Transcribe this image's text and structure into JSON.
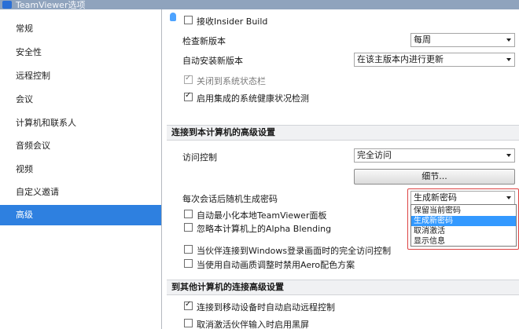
{
  "window": {
    "title": "TeamViewer选项"
  },
  "sidebar": {
    "items": [
      {
        "label": "常规"
      },
      {
        "label": "安全性"
      },
      {
        "label": "远程控制"
      },
      {
        "label": "会议"
      },
      {
        "label": "计算机和联系人"
      },
      {
        "label": "音频会议"
      },
      {
        "label": "视频"
      },
      {
        "label": "自定义邀请"
      },
      {
        "label": "高级",
        "active": true
      }
    ]
  },
  "general": {
    "insider_label": "接收Insider Build",
    "check_version_label": "检查新版本",
    "check_version_value": "每周",
    "auto_install_label": "自动安装新版本",
    "auto_install_value": "在该主版本内进行更新",
    "close_tray_label": "关闭到系统状态栏",
    "health_check_label": "启用集成的系统健康状况检测"
  },
  "incoming": {
    "section_title": "连接到本计算机的高级设置",
    "access_label": "访问控制",
    "access_value": "完全访问",
    "details_button": "细节...",
    "random_pw_label": "每次会话后随机生成密码",
    "random_pw_value": "生成新密码",
    "random_pw_options": [
      "保留当前密码",
      "生成新密码",
      "取消激活",
      "显示信息"
    ],
    "minimize_label": "自动最小化本地TeamViewer面板",
    "alpha_label": "忽略本计算机上的Alpha Blending",
    "fullaccess_label": "当伙伴连接到Windows登录画面时的完全访问控制",
    "aero_label": "当使用自动画质调整时禁用Aero配色方案"
  },
  "outgoing": {
    "section_title": "到其他计算机的连接高级设置",
    "mobile_label": "连接到移动设备时自动启动远程控制",
    "blackscreen_label": "取消激活伙伴输入时启用黑屏"
  }
}
